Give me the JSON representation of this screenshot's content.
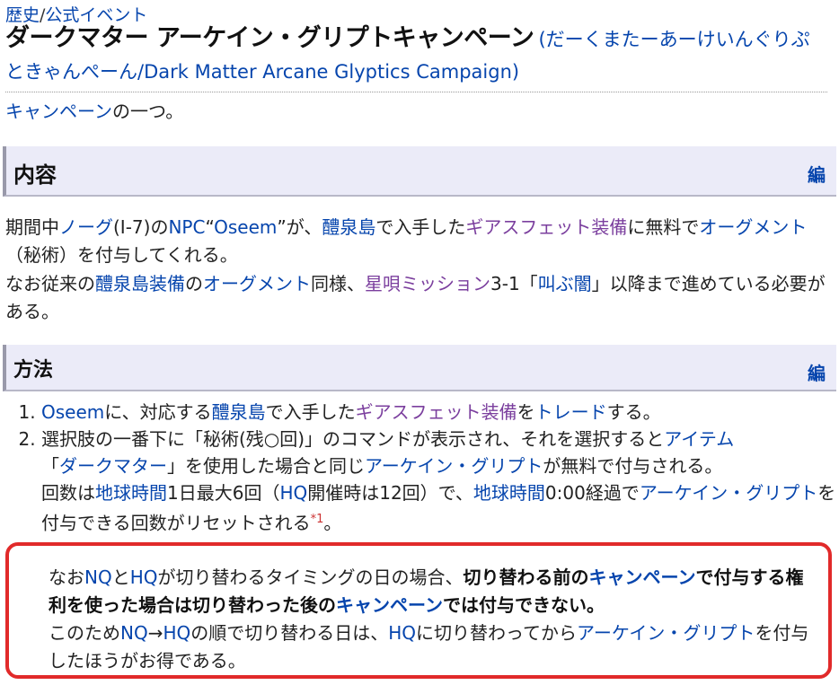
{
  "breadcrumb": {
    "part1": "歴史",
    "sep": "/",
    "part2": "公式イベント"
  },
  "title": {
    "main": "ダークマター アーケイン・グリプトキャンペーン",
    "reading": "(だーくまたーあーけいんぐりぷときゃんぺーん/Dark Matter Arcane Glyptics Campaign)"
  },
  "intro": {
    "link": "キャンペーン",
    "text": "の一つ。"
  },
  "sections": [
    {
      "title": "内容",
      "edit": "編"
    },
    {
      "title": "方法",
      "edit": "編"
    }
  ],
  "content": {
    "p1": {
      "t1": "期間中",
      "l1": "ノーグ",
      "t2": "(I-7)の",
      "l2": "NPC",
      "t3": "“",
      "l3": "Oseem",
      "t4": "”が、",
      "l4": "醴泉島",
      "t5": "で入手した",
      "l5": "ギアスフェット装備",
      "t6": "に無料で",
      "l6": "オーグメント",
      "t7": "（秘術）を付与してくれる。"
    },
    "p2": {
      "t1": "なお従来の",
      "l1": "醴泉島装備",
      "t2": "の",
      "l2": "オーグメント",
      "t3": "同様、",
      "l3": "星唄ミッション",
      "t4": "3-1「",
      "l4": "叫ぶ闇",
      "t5": "」以降まで進めている必要がある。"
    }
  },
  "steps": [
    {
      "l1": "Oseem",
      "t1": "に、対応する",
      "l2": "醴泉島",
      "t2": "で入手した",
      "l3": "ギアスフェット装備",
      "t3": "を",
      "l4": "トレード",
      "t4": "する。"
    },
    {
      "t1": "選択肢の一番下に「秘術(残○回)」のコマンドが表示され、それを選択すると",
      "l1": "アイテム",
      "t2": "「",
      "l2": "ダークマター",
      "t3": "」を使用した場合と同じ",
      "l3": "アーケイン・グリプト",
      "t4": "が無料で付与される。",
      "t5": "回数は",
      "l4": "地球時間",
      "t6": "1日最大6回（",
      "l5": "HQ",
      "t7": "開催時は12回）で、",
      "l6": "地球時間",
      "l7": "0:00",
      "t8": "経過で",
      "l8": "アーケイン・グリプト",
      "t9": "を付与できる回数がリセットされる",
      "note": "*1",
      "t10": "。"
    }
  ],
  "callout": {
    "t1": "なお",
    "l1": "NQ",
    "t2": "と",
    "l2": "HQ",
    "t3": "が切り替わるタイミングの日の場合、",
    "b1": "切り替わる前の",
    "bl1": "キャンペーン",
    "b2": "で付与する権利を使った場合は切り替わった後の",
    "bl2": "キャンペーン",
    "b3": "では付与できない。",
    "t4": "このため",
    "l3": "NQ",
    "t5": "→",
    "l4": "HQ",
    "t6": "の順で切り替わる日は、",
    "l5": "HQ",
    "t7": "に切り替わってから",
    "l6": "アーケイン・グリプト",
    "t8": "を付与したほうがお得である。"
  }
}
